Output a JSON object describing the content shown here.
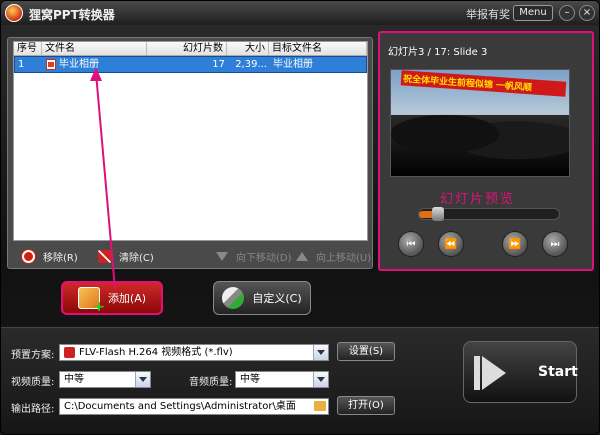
{
  "window": {
    "title": "狸窝PPT转换器",
    "report": "举报有奖",
    "menu": "Menu",
    "minimize": "–",
    "close": "×"
  },
  "file_list": {
    "headers": {
      "index": "序号",
      "name": "文件名",
      "slides": "幻灯片数",
      "size": "大小",
      "target": "目标文件名"
    },
    "rows": [
      {
        "index": "1",
        "name": "毕业相册",
        "slides": "17",
        "size": "2,39...",
        "target": "毕业相册"
      }
    ]
  },
  "list_actions": {
    "remove": "移除(R)",
    "clear": "清除(C)",
    "move_down": "向下移动(D)",
    "move_up": "向上移动(U)"
  },
  "preview": {
    "slide_info": "幻灯片3 / 17: Slide 3",
    "banner_text": "祝全体毕业生前程似锦  一帆风顺",
    "caption": "幻灯片预览",
    "progress": 0.06
  },
  "buttons": {
    "add": "添加(A)",
    "custom": "自定义(C)",
    "settings": "设置(S)",
    "open": "打开(O)",
    "start": "Start"
  },
  "settings": {
    "preset_label": "预置方案:",
    "preset_value": "FLV-Flash H.264 视频格式 (*.flv)",
    "video_quality_label": "视频质量:",
    "video_quality_value": "中等",
    "audio_quality_label": "音频质量:",
    "audio_quality_value": "中等",
    "output_label": "输出路径:",
    "output_value": "C:\\Documents and Settings\\Administrator\\桌面"
  },
  "colors": {
    "accent_pink": "#e0107a",
    "selection_blue": "#2d7fd8",
    "add_button_red": "#c01818"
  }
}
